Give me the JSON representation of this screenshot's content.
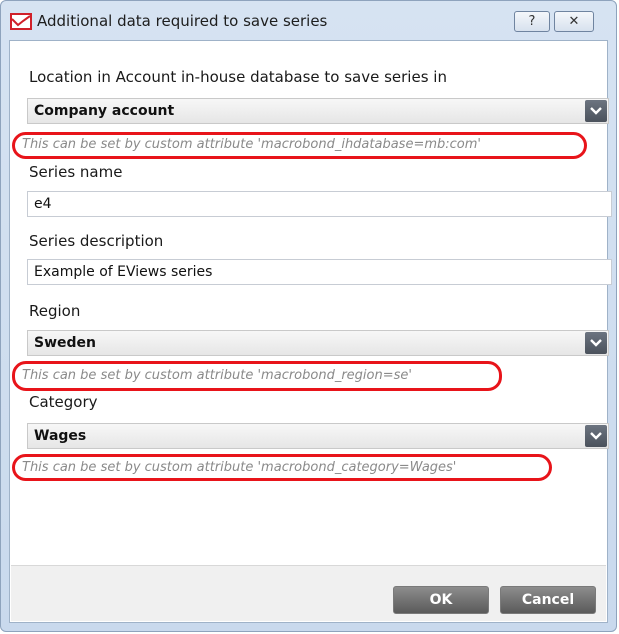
{
  "window": {
    "title": "Additional data required to save series",
    "help_glyph": "?",
    "close_glyph": "✕"
  },
  "form": {
    "location_label": "Location in Account in-house database to save series in",
    "location_value": "Company account",
    "location_hint": "This can be set by custom attribute 'macrobond_ihdatabase=mb:com'",
    "series_name_label": "Series name",
    "series_name_value": "e4",
    "series_description_label": "Series description",
    "series_description_value": "Example of EViews series",
    "region_label": "Region",
    "region_value": "Sweden",
    "region_hint": "This can be set by custom attribute 'macrobond_region=se'",
    "category_label": "Category",
    "category_value": "Wages",
    "category_hint": "This can be set by custom attribute 'macrobond_category=Wages'"
  },
  "footer": {
    "ok_label": "OK",
    "cancel_label": "Cancel"
  },
  "colors": {
    "highlight": "#e8141a",
    "app_icon": "#d0202a",
    "title_bar": "#d6e3f2"
  },
  "icons": {
    "app": "chart-line-icon",
    "dropdown": "chevron-down-icon"
  }
}
